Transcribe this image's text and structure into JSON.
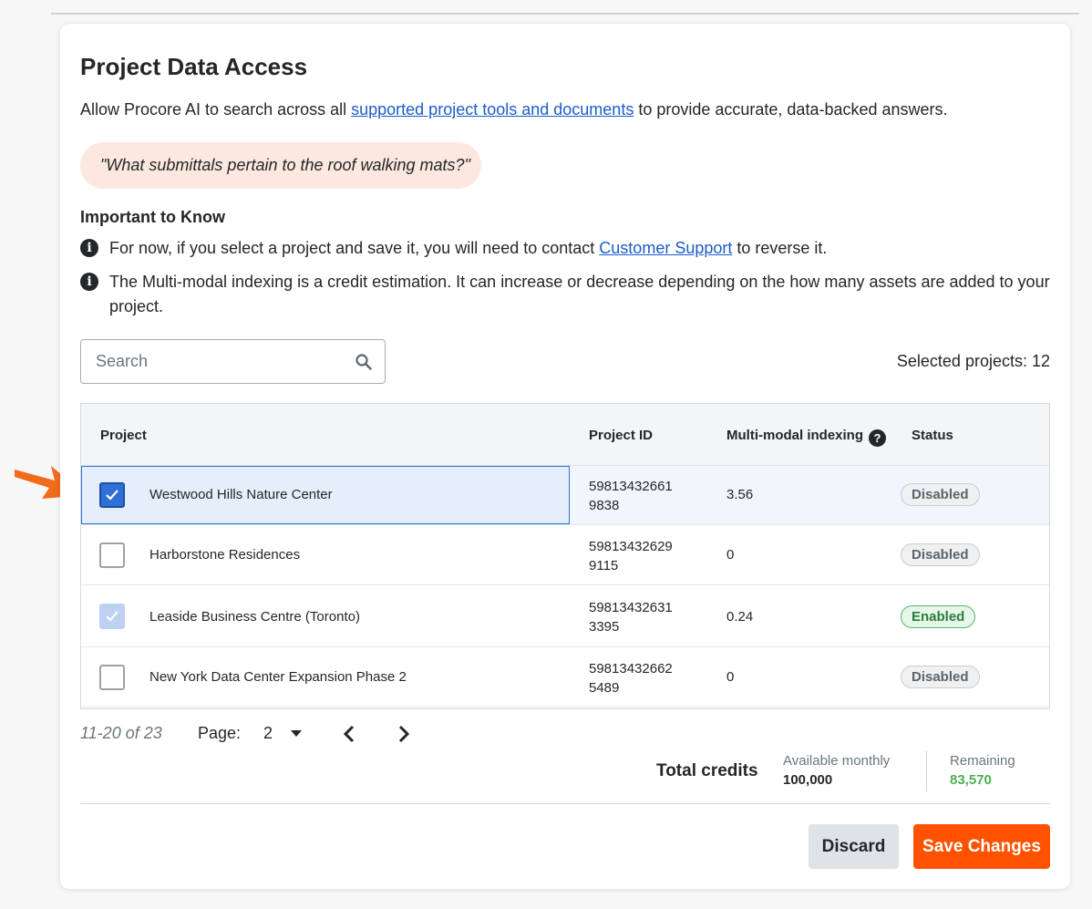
{
  "title": "Project Data Access",
  "intro": {
    "prefix": "Allow Procore AI to search across all ",
    "link": "supported project tools and documents",
    "suffix": " to provide accurate, data-backed answers."
  },
  "example_query": "\"What submittals pertain to the roof walking mats?\"",
  "important": {
    "heading": "Important to Know",
    "note1_prefix": "For now, if you select a project and save it, you will need to contact ",
    "note1_link": "Customer Support",
    "note1_suffix": " to reverse it.",
    "note2": "The Multi-modal indexing is a credit estimation. It can increase or decrease depending on the how many assets are added to your project."
  },
  "search": {
    "placeholder": "Search"
  },
  "selected_projects": "Selected projects: 12",
  "table": {
    "headers": {
      "project": "Project",
      "project_id": "Project ID",
      "indexing": "Multi-modal indexing",
      "status": "Status"
    },
    "rows": [
      {
        "name": "Westwood Hills Nature Center",
        "id_line1": "59813432661",
        "id_line2": "9838",
        "indexing": "3.56",
        "status": "Disabled",
        "checked": "checked"
      },
      {
        "name": "Harborstone Residences",
        "id_line1": "59813432629",
        "id_line2": "9115",
        "indexing": "0",
        "status": "Disabled",
        "checked": "unchecked"
      },
      {
        "name": "Leaside Business Centre (Toronto)",
        "id_line1": "59813432631",
        "id_line2": "3395",
        "indexing": "0.24",
        "status": "Enabled",
        "checked": "checked-disabled"
      },
      {
        "name": "New York Data Center Expansion Phase 2",
        "id_line1": "59813432662",
        "id_line2": "5489",
        "indexing": "0",
        "status": "Disabled",
        "checked": "unchecked"
      }
    ]
  },
  "pager": {
    "range": "11-20 of 23",
    "page_label": "Page:",
    "page": "2",
    "prev_icon": "chevron-left-icon",
    "next_icon": "chevron-right-icon"
  },
  "credits": {
    "label": "Total credits",
    "available_label": "Available monthly",
    "available_value": "100,000",
    "remaining_label": "Remaining",
    "remaining_value": "83,570",
    "remaining_color": "#4cb050"
  },
  "buttons": {
    "discard": "Discard",
    "save": "Save Changes"
  },
  "colors": {
    "accent": "#ff5200",
    "link": "#1d5cc9",
    "arrow": "#f26a1b"
  }
}
